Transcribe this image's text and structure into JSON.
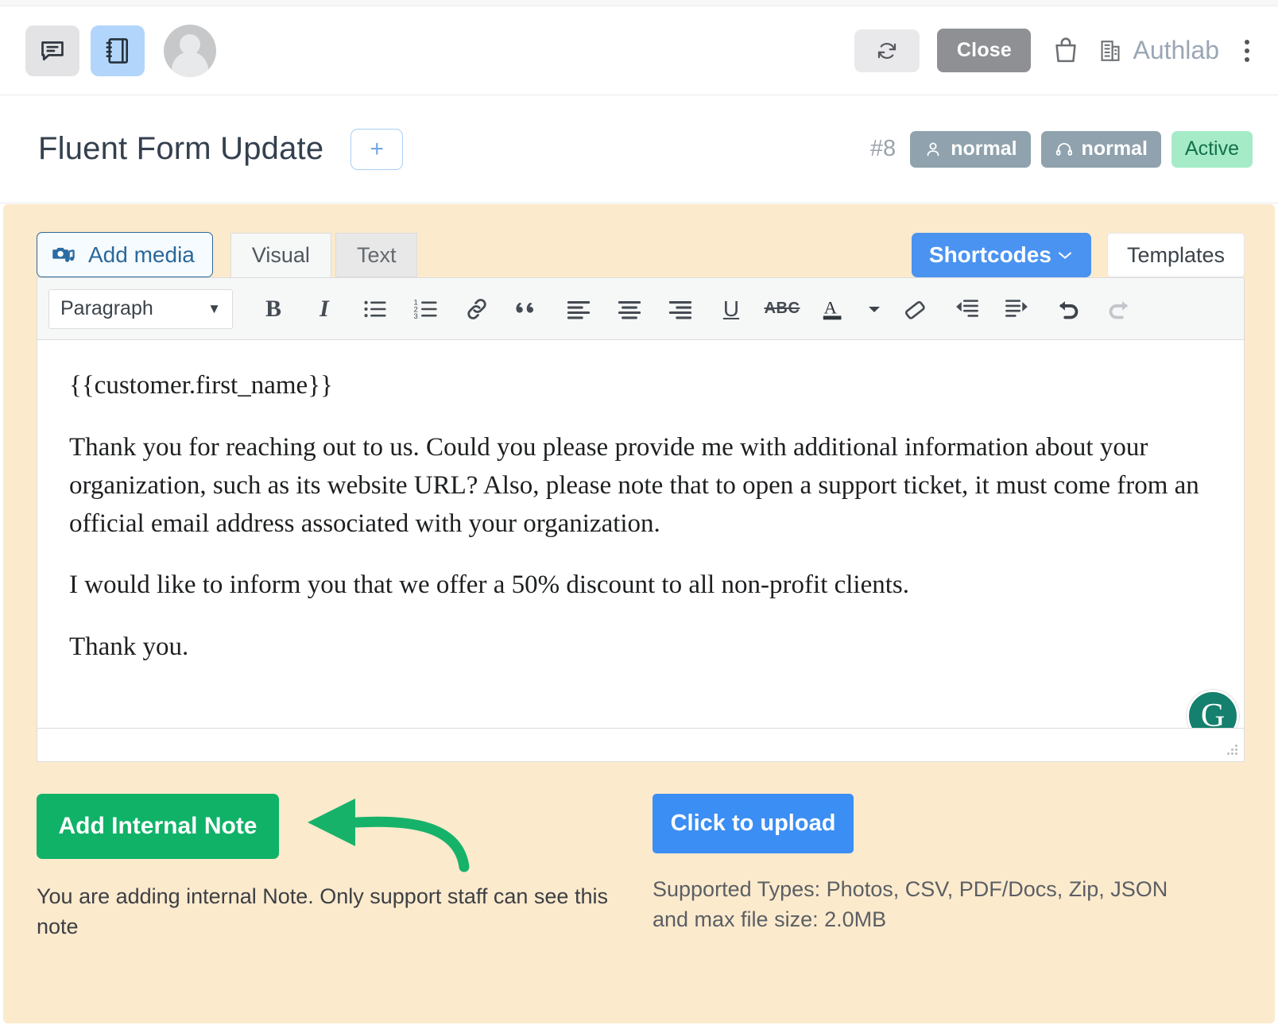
{
  "topbar": {
    "chat_icon": "chat-bubble-icon",
    "notebook_icon": "notebook-icon",
    "avatar_icon": "user-avatar",
    "refresh_icon": "refresh-icon",
    "close_label": "Close",
    "bag_icon": "shopping-bag-icon",
    "org_icon": "building-icon",
    "org_name": "Authlab",
    "kebab_icon": "kebab-menu-icon"
  },
  "title_row": {
    "title": "Fluent Form Update",
    "add_label": "+",
    "ticket_number": "#8",
    "badges": [
      {
        "icon": "person-icon",
        "label": "normal",
        "color": "#8fa2ad"
      },
      {
        "icon": "headset-icon",
        "label": "normal",
        "color": "#8fa2ad"
      },
      {
        "icon": "",
        "label": "Active",
        "color": "#a5ebc8"
      }
    ]
  },
  "editor": {
    "add_media_label": "Add media",
    "add_media_icon": "media-camera-music-icon",
    "tabs": [
      {
        "label": "Visual",
        "active": true
      },
      {
        "label": "Text",
        "active": false
      }
    ],
    "shortcodes_label": "Shortcodes",
    "shortcodes_caret": "chevron-down-icon",
    "templates_label": "Templates",
    "format_select": {
      "value": "Paragraph",
      "caret": "▼"
    },
    "toolbar_buttons": [
      "bold",
      "italic",
      "bulleted-list",
      "numbered-list",
      "insert-link",
      "blockquote",
      "align-left",
      "align-center",
      "align-right",
      "underline",
      "strikethrough",
      "text-color",
      "text-color-caret",
      "clear-formatting",
      "outdent",
      "indent",
      "undo",
      "redo"
    ],
    "bold_glyph": "B",
    "italic_glyph": "I",
    "underline_glyph": "U",
    "strike_glyph": "ABC",
    "textcolor_glyph": "A",
    "body_paragraphs": [
      "{{customer.first_name}}",
      "Thank you for reaching out to us. Could you please provide me with additional information about your organization, such as its website URL? Also, please note that to open a support ticket, it must come from an official email address associated with your organization.",
      "I would like to inform you that we offer a 50% discount to all non-profit clients.",
      "Thank you."
    ],
    "grammarly_glyph": "G",
    "grammarly_name": "grammarly-badge",
    "resize_grip": "resize-handle"
  },
  "footer": {
    "add_note_label": "Add Internal Note",
    "note_help": "You are adding internal Note. Only support staff can see this note",
    "upload_label": "Click to upload",
    "upload_help": "Supported Types: Photos, CSV, PDF/Docs, Zip, JSON and max file size: 2.0MB",
    "annotation_arrow": "green-callout-arrow"
  },
  "colors": {
    "panel_bg": "#fceacd",
    "accent_blue": "#3b8ef3",
    "accent_green": "#10b268",
    "badge_grey": "#8fa2ad",
    "badge_active": "#a5ebc8",
    "close_grey": "#8e9094"
  }
}
